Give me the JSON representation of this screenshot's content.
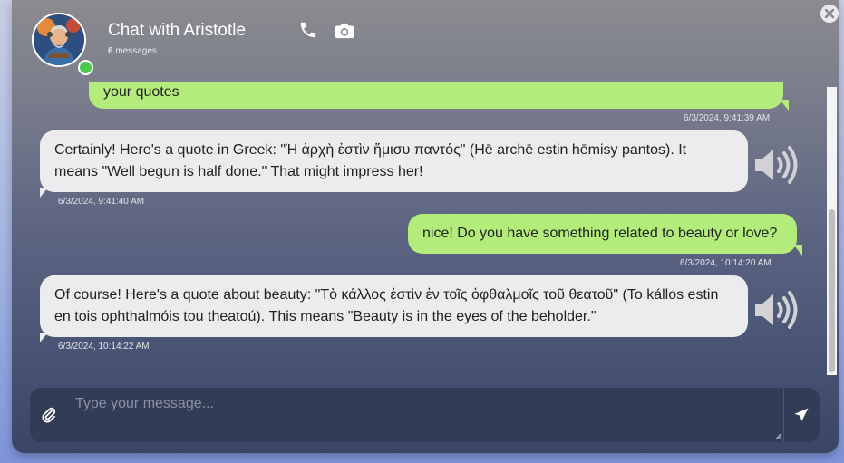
{
  "header": {
    "title": "Chat with Aristotle",
    "message_count": "6",
    "message_count_label": "messages",
    "status_color": "#4cc94c"
  },
  "icons": {
    "phone": "phone-icon",
    "camera": "camera-icon",
    "close": "close-icon",
    "speaker": "speaker-icon",
    "attach": "paperclip-icon",
    "send": "send-icon"
  },
  "messages": [
    {
      "role": "user",
      "text": "your quotes",
      "timestamp": "6/3/2024, 9:41:39 AM"
    },
    {
      "role": "assistant",
      "text": "Certainly! Here's a quote in Greek: \"Ἡ ἀρχὴ ἐστὶν ἥμισυ παντός\" (Hē archē estin hēmisy pantos). It means \"Well begun is half done.\" That might impress her!",
      "timestamp": "6/3/2024, 9:41:40 AM"
    },
    {
      "role": "user",
      "text": "nice! Do you have something related to beauty or love?",
      "timestamp": "6/3/2024, 10:14:20 AM"
    },
    {
      "role": "assistant",
      "text": "Of course! Here's a quote about beauty: \"Τὸ κάλλος ἐστὶν ἐν τοῖς ὀφθαλμοῖς τοῦ θεατοῦ\" (To kállos estin en tois ophthalmóis tou theatoú). This means \"Beauty is in the eyes of the beholder.\"",
      "timestamp": "6/3/2024, 10:14:22 AM"
    }
  ],
  "composer": {
    "placeholder": "Type your message...",
    "value": ""
  },
  "colors": {
    "user_bubble": "#b3ec7a",
    "assistant_bubble": "#ececee",
    "composer_bg": "#333c57"
  }
}
